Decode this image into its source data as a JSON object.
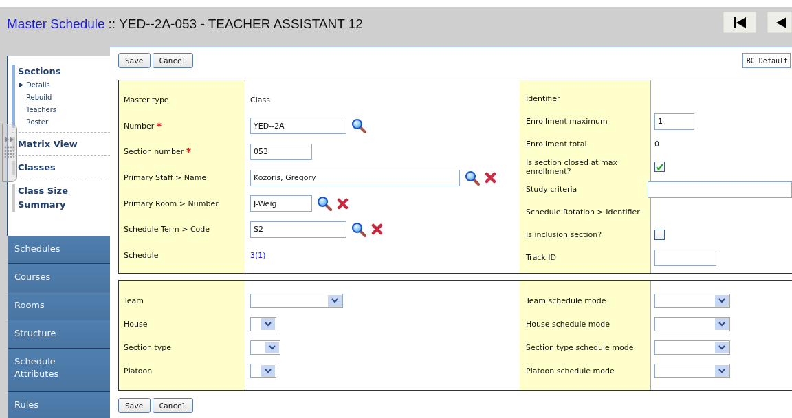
{
  "header": {
    "app_link": "Master Schedule",
    "separator": "::",
    "title": "YED--2A-053 - TEACHER ASSISTANT 12"
  },
  "sidebar": {
    "groups": [
      {
        "label": "Sections",
        "selected": true,
        "children": [
          {
            "label": "Details",
            "selected": true
          },
          {
            "label": "Rebuild",
            "selected": false
          },
          {
            "label": "Teachers",
            "selected": false
          },
          {
            "label": "Roster",
            "selected": false
          }
        ]
      },
      {
        "label": "Matrix View",
        "selected": false
      },
      {
        "label": "Classes",
        "selected": false
      },
      {
        "label": "Class Size Summary",
        "selected": false
      }
    ],
    "tabs": [
      "Schedules",
      "Courses",
      "Rooms",
      "Structure",
      "Schedule Attributes",
      "Rules"
    ]
  },
  "toolbar": {
    "buttons": [
      "Save",
      "Cancel"
    ],
    "template_button": "BC Default"
  },
  "main_left": [
    {
      "label": "Master type",
      "kind": "text",
      "value": "Class"
    },
    {
      "label": "Number",
      "kind": "input",
      "value": "YED--2A",
      "required": true,
      "lookup": true,
      "clear": false
    },
    {
      "label": "Section number",
      "kind": "input",
      "value": "053",
      "required": true,
      "lookup": false,
      "clear": false
    },
    {
      "label": "Primary Staff > Name",
      "kind": "input",
      "value": "Kozoris, Gregory",
      "required": false,
      "lookup": true,
      "clear": true
    },
    {
      "label": "Primary Room > Number",
      "kind": "input",
      "value": "J-Weig",
      "required": false,
      "lookup": true,
      "clear": true
    },
    {
      "label": "Schedule Term > Code",
      "kind": "input",
      "value": "S2",
      "required": false,
      "lookup": true,
      "clear": true
    },
    {
      "label": "Schedule",
      "kind": "link",
      "value": "3(1)"
    }
  ],
  "main_right": [
    {
      "label": "Identifier",
      "kind": "empty"
    },
    {
      "label": "Enrollment maximum",
      "kind": "input",
      "value": "1"
    },
    {
      "label": "Enrollment total",
      "kind": "text",
      "value": "0"
    },
    {
      "label": "Is section closed at max enrollment?",
      "kind": "checkbox",
      "checked": true
    },
    {
      "label": "Study criteria",
      "kind": "input"
    },
    {
      "label": "Schedule Rotation > Identifier",
      "kind": "empty"
    },
    {
      "label": "Is inclusion section?",
      "kind": "checkbox",
      "checked": false
    },
    {
      "label": "Track ID",
      "kind": "input"
    }
  ],
  "grouping_left": [
    {
      "label": "Team"
    },
    {
      "label": "House"
    },
    {
      "label": "Section type"
    },
    {
      "label": "Platoon"
    }
  ],
  "grouping_right": [
    {
      "label": "Team schedule mode"
    },
    {
      "label": "House schedule mode"
    },
    {
      "label": "Section type schedule mode"
    },
    {
      "label": "Platoon schedule mode"
    }
  ],
  "footer_buttons": [
    "Save",
    "Cancel"
  ]
}
